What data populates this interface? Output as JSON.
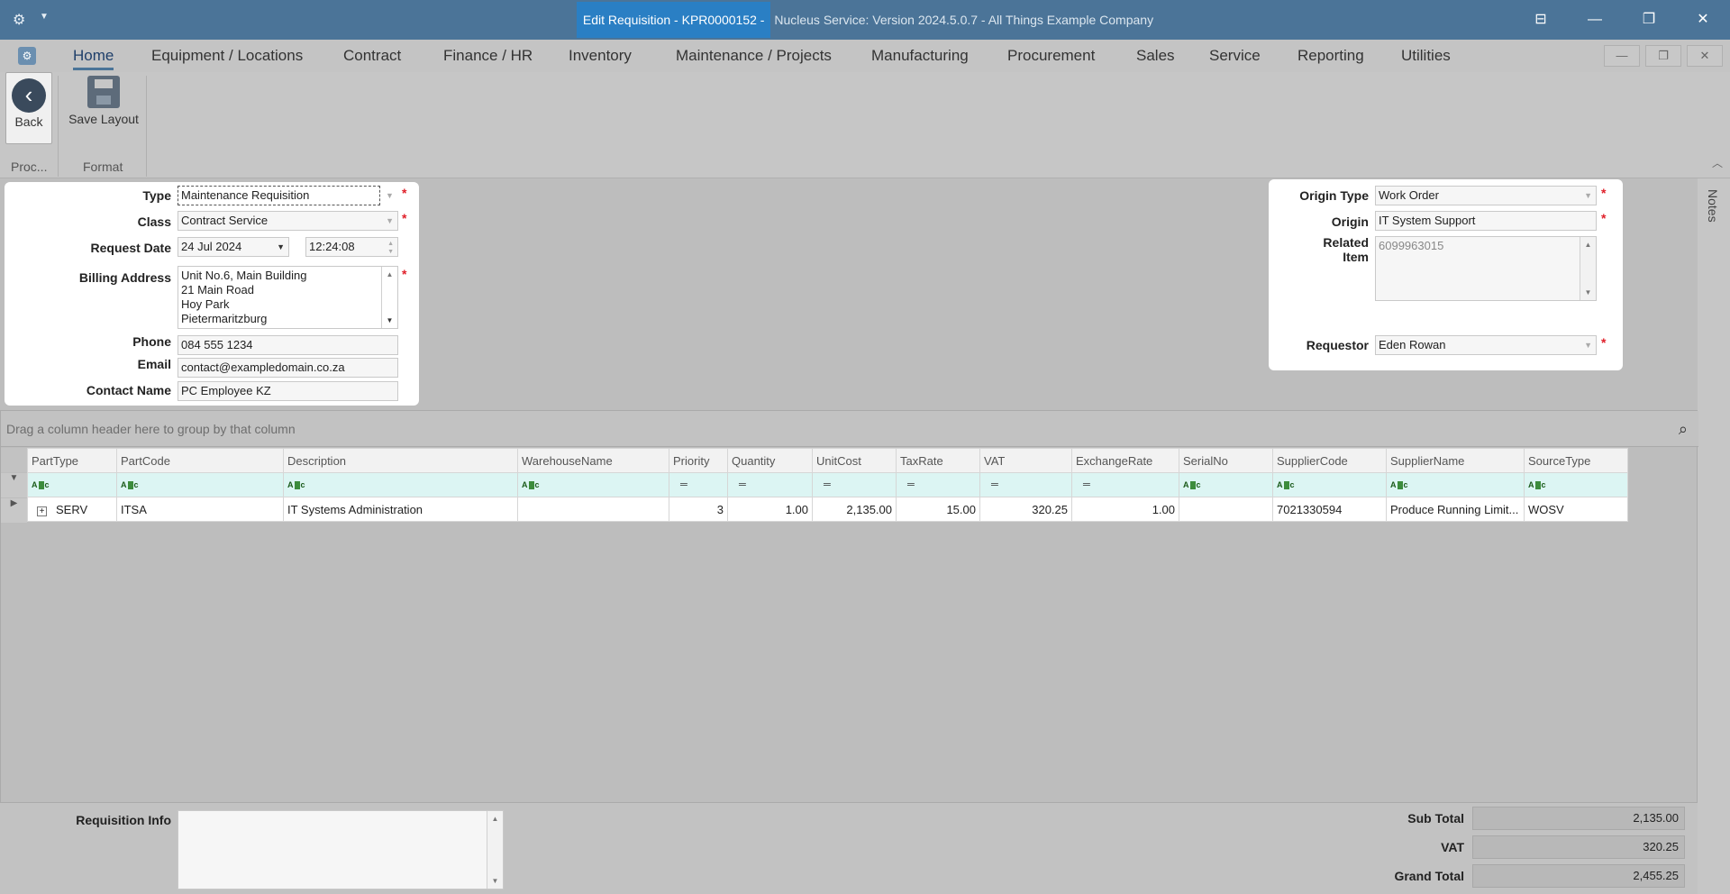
{
  "window": {
    "title_highlight": "Edit Requisition - KPR0000152 -",
    "title_rest": "Nucleus Service: Version 2024.5.0.7 - All Things Example Company"
  },
  "tabs": [
    "Home",
    "Equipment / Locations",
    "Contract",
    "Finance / HR",
    "Inventory",
    "Maintenance / Projects",
    "Manufacturing",
    "Procurement",
    "Sales",
    "Service",
    "Reporting",
    "Utilities"
  ],
  "ribbon": {
    "back_label": "Back",
    "save_layout_label": "Save Layout",
    "group_process": "Proc...",
    "group_format": "Format"
  },
  "form": {
    "type_label": "Type",
    "type_value": "Maintenance Requisition",
    "class_label": "Class",
    "class_value": "Contract Service",
    "request_date_label": "Request Date",
    "request_date": "24 Jul 2024",
    "request_time": "12:24:08",
    "billing_label": "Billing Address",
    "billing_lines": [
      "Unit No.6, Main Building",
      "21 Main Road",
      "Hoy Park",
      "Pietermaritzburg"
    ],
    "phone_label": "Phone",
    "phone_value": "084 555 1234",
    "email_label": "Email",
    "email_value": "contact@exampledomain.co.za",
    "contact_label": "Contact Name",
    "contact_value": "PC Employee KZ"
  },
  "origin": {
    "origin_type_label": "Origin Type",
    "origin_type_value": "Work Order",
    "origin_label": "Origin",
    "origin_value": "IT System Support",
    "related_label_1": "Related",
    "related_label_2": "Item",
    "related_value": "6099963015",
    "requestor_label": "Requestor",
    "requestor_value": "Eden Rowan"
  },
  "notes_label": "Notes",
  "grid": {
    "group_hint": "Drag a column header here to group by that column",
    "columns": [
      "PartType",
      "PartCode",
      "Description",
      "WarehouseName",
      "Priority",
      "Quantity",
      "UnitCost",
      "TaxRate",
      "VAT",
      "ExchangeRate",
      "SerialNo",
      "SupplierCode",
      "SupplierName",
      "SourceType"
    ],
    "rows": [
      {
        "PartType": "SERV",
        "PartCode": "ITSA",
        "Description": "IT Systems Administration",
        "WarehouseName": "",
        "Priority": "3",
        "Quantity": "1.00",
        "UnitCost": "2,135.00",
        "TaxRate": "15.00",
        "VAT": "320.25",
        "ExchangeRate": "1.00",
        "SerialNo": "",
        "SupplierCode": "7021330594",
        "SupplierName": "Produce Running Limit...",
        "SourceType": "WOSV"
      }
    ]
  },
  "footer": {
    "req_info_label": "Requisition Info",
    "subtotal_label": "Sub Total",
    "subtotal_value": "2,135.00",
    "vat_label": "VAT",
    "vat_value": "320.25",
    "grand_total_label": "Grand Total",
    "grand_total_value": "2,455.25"
  }
}
